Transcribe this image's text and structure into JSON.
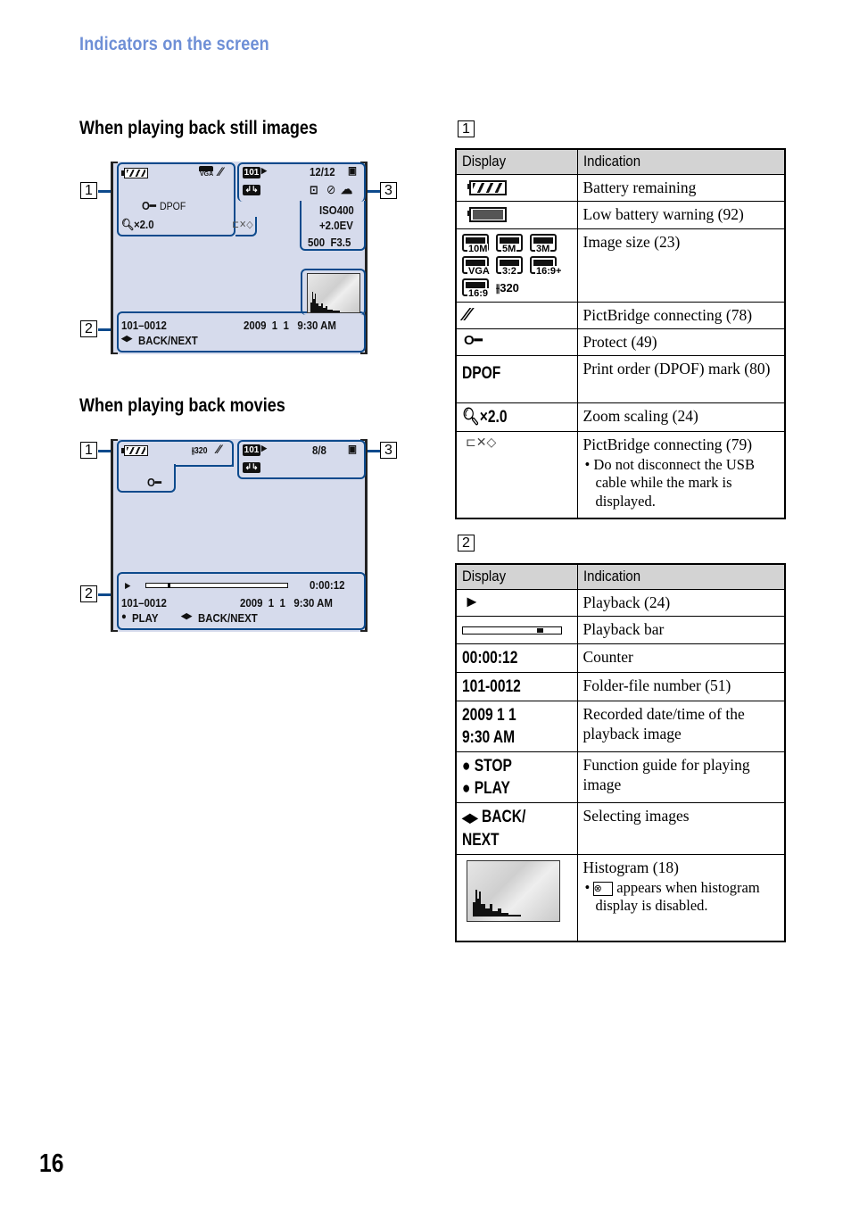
{
  "page": {
    "section_title": "Indicators on the screen",
    "page_number": "16"
  },
  "still_screen": {
    "heading": "When playing back still images",
    "callouts": [
      "1",
      "2",
      "3"
    ],
    "zone1": {
      "battery_icon": "battery-full-icon",
      "image_size": "VGA",
      "pictbridge_icon": "pictbridge-connecting-icon",
      "protect_icon": "key-icon",
      "dpof": "DPOF",
      "zoom": "×2.0",
      "usb_icon": "usb-disconnect-warning-icon"
    },
    "zone3": {
      "folder": "101",
      "count": "12/12",
      "iso": "ISO400",
      "ev": "+2.0EV",
      "shutter_aperture": "500  F3.5"
    },
    "zone2": {
      "file_number": "101–0012",
      "datetime": "2009  1  1   9:30 AM",
      "nav": "BACK/NEXT"
    }
  },
  "movie_screen": {
    "heading": "When playing back movies",
    "callouts": [
      "1",
      "2",
      "3"
    ],
    "zone1": {
      "image_size": "320"
    },
    "zone3": {
      "folder": "101",
      "count": "8/8"
    },
    "zone2": {
      "counter": "0:00:12",
      "file_number": "101–0012",
      "datetime": "2009  1  1   9:30 AM",
      "play": "PLAY",
      "nav": "BACK/NEXT",
      "progress": 0.15
    }
  },
  "table1": {
    "label": "1",
    "headers": [
      "Display",
      "Indication"
    ],
    "rows": [
      {
        "icon": "battery-remaining-icon",
        "indication": "Battery remaining"
      },
      {
        "icon": "low-battery-icon",
        "indication": "Low battery warning (92)"
      },
      {
        "icon": "image-size-icons",
        "sizes": [
          "10M",
          "5M",
          "3M",
          "VGA",
          "3:2",
          "16:9+",
          "16:9",
          "320"
        ],
        "indication": "Image size (23)"
      },
      {
        "icon": "pictbridge-connecting-icon",
        "indication": "PictBridge connecting (78)"
      },
      {
        "icon": "protect-key-icon",
        "indication": "Protect (49)"
      },
      {
        "display": "DPOF",
        "indication": "Print order (DPOF) mark (80)"
      },
      {
        "display": "×2.0",
        "indication": "Zoom scaling (24)"
      },
      {
        "icon": "usb-pictbridge-icon",
        "indication": "PictBridge connecting (79)",
        "note": "Do not disconnect the USB cable while the mark is displayed."
      }
    ]
  },
  "table2": {
    "label": "2",
    "headers": [
      "Display",
      "Indication"
    ],
    "rows": [
      {
        "icon": "play-triangle-icon",
        "indication": "Playback (24)"
      },
      {
        "icon": "playback-bar",
        "progress": 0.75,
        "indication": "Playback bar"
      },
      {
        "display": "00:00:12",
        "indication": "Counter"
      },
      {
        "display": "101-0012",
        "indication": "Folder-file number (51)"
      },
      {
        "display_lines": [
          "2009 1 1",
          "9:30 AM"
        ],
        "indication": "Recorded date/time of the playback image"
      },
      {
        "display_lines": [
          "STOP",
          "PLAY"
        ],
        "indication": "Function guide for playing image"
      },
      {
        "display_lines": [
          "BACK/",
          "NEXT"
        ],
        "indication": "Selecting images"
      },
      {
        "icon": "histogram-thumbnail",
        "indication": "Histogram (18)",
        "note_symbol": "⊗",
        "note": "appears when histogram display is disabled."
      }
    ]
  }
}
